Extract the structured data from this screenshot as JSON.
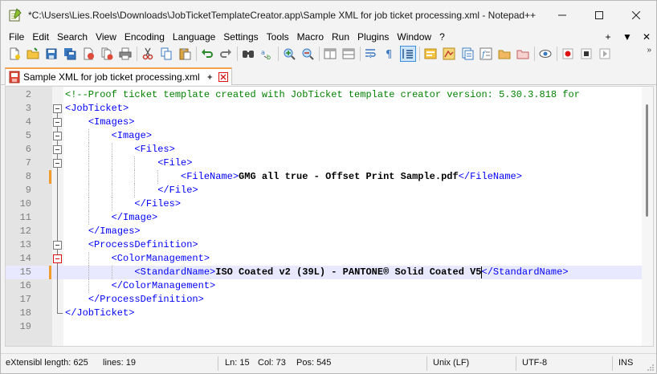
{
  "window": {
    "title": "*C:\\Users\\Lies.Roels\\Downloads\\JobTicketTemplateCreator.app\\Sample XML for job ticket processing.xml - Notepad++"
  },
  "menu": {
    "items": [
      "File",
      "Edit",
      "Search",
      "View",
      "Encoding",
      "Language",
      "Settings",
      "Tools",
      "Macro",
      "Run",
      "Plugins",
      "Window",
      "?"
    ],
    "right": [
      "+",
      "▼",
      "✕"
    ]
  },
  "toolbar": {
    "icons": [
      "new-file-icon",
      "open-file-icon",
      "save-icon",
      "save-all-icon",
      "close-icon",
      "close-all-icon",
      "print-icon",
      "cut-icon",
      "copy-icon",
      "paste-icon",
      "undo-icon",
      "redo-icon",
      "find-icon",
      "replace-icon",
      "zoom-in-icon",
      "zoom-out-icon",
      "sync-vertical-icon",
      "sync-horizontal-icon",
      "word-wrap-icon",
      "show-all-chars-icon",
      "indent-guide-icon",
      "define-language-icon",
      "document-map-icon",
      "function-list-icon",
      "folder-workspace-icon",
      "monitoring-icon",
      "record-macro-icon",
      "stop-record-icon",
      "play-macro-icon"
    ],
    "overflow": "»"
  },
  "tab": {
    "label": "Sample XML for job ticket processing.xml"
  },
  "editor": {
    "lines": [
      {
        "n": "2",
        "segments": [
          {
            "t": "<!--Proof ticket template created with JobTicket template creator version: 5.30.3.818 for",
            "c": "cmt"
          }
        ]
      },
      {
        "n": "3",
        "segments": [
          {
            "t": "<JobTicket>",
            "c": "tag"
          }
        ]
      },
      {
        "n": "4",
        "segments": [
          {
            "t": "    ",
            "c": "txt"
          },
          {
            "t": "<Images>",
            "c": "tag"
          }
        ]
      },
      {
        "n": "5",
        "segments": [
          {
            "t": "        ",
            "c": "txt"
          },
          {
            "t": "<Image>",
            "c": "tag"
          }
        ]
      },
      {
        "n": "6",
        "segments": [
          {
            "t": "            ",
            "c": "txt"
          },
          {
            "t": "<Files>",
            "c": "tag"
          }
        ]
      },
      {
        "n": "7",
        "segments": [
          {
            "t": "                ",
            "c": "txt"
          },
          {
            "t": "<File>",
            "c": "tag"
          }
        ]
      },
      {
        "n": "8",
        "segments": [
          {
            "t": "                    ",
            "c": "txt"
          },
          {
            "t": "<FileName>",
            "c": "tag"
          },
          {
            "t": "GMG all true - Offset Print Sample.pdf",
            "c": "txt"
          },
          {
            "t": "</FileName>",
            "c": "tag"
          }
        ]
      },
      {
        "n": "9",
        "segments": [
          {
            "t": "                ",
            "c": "txt"
          },
          {
            "t": "</File>",
            "c": "tag"
          }
        ]
      },
      {
        "n": "10",
        "segments": [
          {
            "t": "            ",
            "c": "txt"
          },
          {
            "t": "</Files>",
            "c": "tag"
          }
        ]
      },
      {
        "n": "11",
        "segments": [
          {
            "t": "        ",
            "c": "txt"
          },
          {
            "t": "</Image>",
            "c": "tag"
          }
        ]
      },
      {
        "n": "12",
        "segments": [
          {
            "t": "    ",
            "c": "txt"
          },
          {
            "t": "</Images>",
            "c": "tag"
          }
        ]
      },
      {
        "n": "13",
        "segments": [
          {
            "t": "    ",
            "c": "txt"
          },
          {
            "t": "<ProcessDefinition>",
            "c": "tag"
          }
        ]
      },
      {
        "n": "14",
        "segments": [
          {
            "t": "        ",
            "c": "txt"
          },
          {
            "t": "<ColorManagement>",
            "c": "tag"
          }
        ]
      },
      {
        "n": "15",
        "segments": [
          {
            "t": "            ",
            "c": "txt"
          },
          {
            "t": "<StandardName>",
            "c": "tag"
          },
          {
            "t": "ISO Coated v2 (39L) - PANTONE® Solid Coated V5",
            "c": "txt"
          },
          {
            "t": "</StandardName>",
            "c": "tag"
          }
        ]
      },
      {
        "n": "16",
        "segments": [
          {
            "t": "        ",
            "c": "txt"
          },
          {
            "t": "</ColorManagement>",
            "c": "tag"
          }
        ]
      },
      {
        "n": "17",
        "segments": [
          {
            "t": "    ",
            "c": "txt"
          },
          {
            "t": "</ProcessDefinition>",
            "c": "tag"
          }
        ]
      },
      {
        "n": "18",
        "segments": [
          {
            "t": "</JobTicket>",
            "c": "tag"
          }
        ]
      },
      {
        "n": "19",
        "segments": []
      }
    ]
  },
  "status": {
    "doc_type": "eXtensibl length: 625",
    "lines": "lines: 19",
    "ln": "Ln: 15",
    "col": "Col: 73",
    "pos": "Pos: 545",
    "eol": "Unix (LF)",
    "encoding": "UTF-8",
    "mode": "INS"
  },
  "colors": {
    "tag": "#0000ff",
    "comment": "#008000",
    "current_line": "#e8e8ff",
    "change_marker": "#f39c2b",
    "tab_accent": "#f8a14c"
  }
}
